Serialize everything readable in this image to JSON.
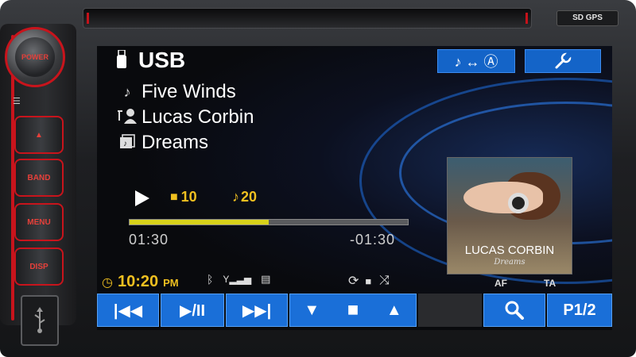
{
  "device": {
    "media_labels": "SD  GPS",
    "buttons": {
      "power": "POWER",
      "eject": "▲",
      "band": "BAND",
      "menu": "MENU",
      "disp": "DISP"
    },
    "accent_color": "#c8141c"
  },
  "screen": {
    "source": "USB",
    "track_title": "Five Winds",
    "artist": "Lucas Corbin",
    "album": "Dreams",
    "folder_number": "10",
    "track_number": "20",
    "elapsed": "01:30",
    "remaining": "-01:30",
    "progress": 0.5,
    "clock_time": "10:20",
    "clock_ampm": "PM",
    "af_label": "AF",
    "ta_label": "TA",
    "album_art": {
      "artist_text": "LUCAS CORBIN",
      "album_text": "Dreams"
    },
    "page_label": "P1/2",
    "button_color": "#1a6fd8",
    "progress_color": "#d8d21a",
    "status_color": "#f0c020"
  },
  "icons": {
    "usb": "usb-icon",
    "note": "music-note-icon",
    "artist": "artist-icon",
    "album": "album-icon",
    "nav_switch": "music-nav-switch-icon",
    "settings": "wrench-icon",
    "bluetooth": "bluetooth-icon",
    "signal": "signal-icon",
    "phone": "phone-icon",
    "repeat": "repeat-icon",
    "folder": "folder-icon",
    "shuffle": "shuffle-icon",
    "prev": "prev-track-icon",
    "playpause": "play-pause-icon",
    "next": "next-track-icon",
    "down": "arrow-down-icon",
    "up": "arrow-up-icon",
    "search": "search-icon"
  }
}
